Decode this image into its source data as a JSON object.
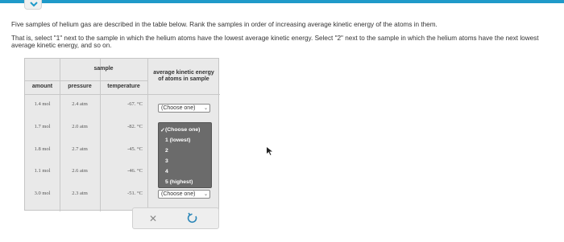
{
  "question": {
    "line1": "Five samples of helium gas are described in the table below. Rank the samples in order of increasing average kinetic energy of the atoms in them.",
    "line2": "That is, select \"1\" next to the sample in which the helium atoms have the lowest average kinetic energy. Select \"2\" next to the sample in which the helium atoms have the next lowest average kinetic energy, and so on."
  },
  "table": {
    "group_header": "sample",
    "col_amount": "amount",
    "col_pressure": "pressure",
    "col_temperature": "temperature",
    "col_ke": "average kinetic energy of atoms in sample",
    "rows": [
      {
        "amount": "1.4 mol",
        "pressure": "2.4 atm",
        "temperature": "-67. °C",
        "selection": "(Choose one)"
      },
      {
        "amount": "1.7 mol",
        "pressure": "2.0 atm",
        "temperature": "-82. °C",
        "selection": ""
      },
      {
        "amount": "1.8 mol",
        "pressure": "2.7 atm",
        "temperature": "-45. °C",
        "selection": ""
      },
      {
        "amount": "1.1 mol",
        "pressure": "2.6 atm",
        "temperature": "-46. °C",
        "selection": ""
      },
      {
        "amount": "3.0 mol",
        "pressure": "2.3 atm",
        "temperature": "-51. °C",
        "selection": "(Choose one)"
      }
    ]
  },
  "dropdown": {
    "options": [
      "(Choose one)",
      "1 (lowest)",
      "2",
      "3",
      "4",
      "5 (highest)"
    ],
    "checked": "(Choose one)"
  },
  "colors": {
    "accent": "#1f9ac9",
    "dropdown_bg": "#6b6b6b",
    "undo": "#2a86b8"
  }
}
